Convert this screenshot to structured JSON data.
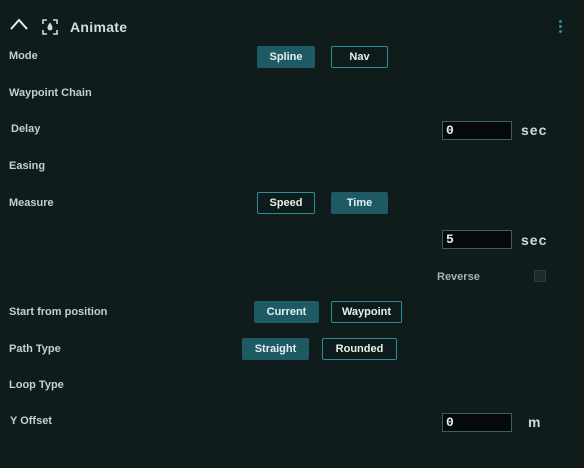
{
  "header": {
    "title": "Animate",
    "collapse_icon": "chevron-up-icon",
    "section_icon": "animate-target-icon",
    "menu_icon": "kebab-menu-icon"
  },
  "mode": {
    "label": "Mode",
    "options": [
      "Spline",
      "Nav"
    ],
    "selected": "Spline"
  },
  "waypoint_chain": {
    "label": "Waypoint Chain"
  },
  "delay": {
    "label": "Delay",
    "value": "0",
    "unit": "sec"
  },
  "easing": {
    "label": "Easing"
  },
  "measure": {
    "label": "Measure",
    "options": [
      "Speed",
      "Time"
    ],
    "selected": "Time"
  },
  "time": {
    "value": "5",
    "unit": "sec"
  },
  "reverse": {
    "label": "Reverse",
    "checked": false
  },
  "start_from_position": {
    "label": "Start from position",
    "options": [
      "Current",
      "Waypoint"
    ],
    "selected": "Current"
  },
  "path_type": {
    "label": "Path Type",
    "options": [
      "Straight",
      "Rounded"
    ],
    "selected": "Straight"
  },
  "loop_type": {
    "label": "Loop Type"
  },
  "y_offset": {
    "label": "Y Offset",
    "value": "0",
    "unit": "m"
  },
  "colors": {
    "background": "#101b1b",
    "selected_button": "#1e5a64",
    "button_border": "#2a8d98",
    "field_background": "#050909"
  }
}
